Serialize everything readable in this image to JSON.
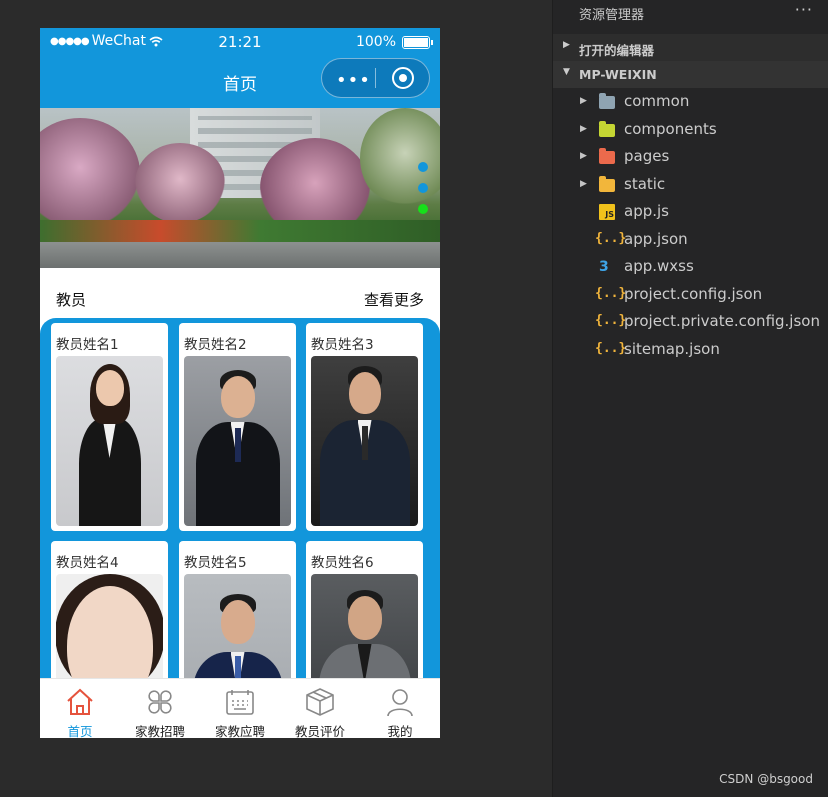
{
  "phone": {
    "status_bar": {
      "signal": "●●●●●",
      "carrier": "WeChat",
      "wifi_icon": "wifi-icon",
      "time": "21:21",
      "battery": "100%"
    },
    "nav": {
      "title": "首页",
      "more_icon": "•••",
      "target_icon": "record-icon"
    },
    "banner": {
      "dots": 3,
      "active_dot": 3,
      "colors": {
        "dot": "#1296db",
        "dot_active": "#16e01a"
      }
    },
    "section": {
      "title": "教员",
      "more": "查看更多"
    },
    "teachers": [
      {
        "name": "教员姓名1"
      },
      {
        "name": "教员姓名2"
      },
      {
        "name": "教员姓名3"
      },
      {
        "name": "教员姓名4"
      },
      {
        "name": "教员姓名5"
      },
      {
        "name": "教员姓名6"
      }
    ],
    "tabs": [
      {
        "label": "首页",
        "icon": "home-icon",
        "active": true
      },
      {
        "label": "家教招聘",
        "icon": "clover-icon",
        "active": false
      },
      {
        "label": "家教应聘",
        "icon": "keyboard-icon",
        "active": false
      },
      {
        "label": "教员评价",
        "icon": "cube-icon",
        "active": false
      },
      {
        "label": "我的",
        "icon": "user-icon",
        "active": false
      }
    ],
    "colors": {
      "primary": "#1296db",
      "tab_active": "#1296db"
    }
  },
  "explorer": {
    "title": "资源管理器",
    "more": "···",
    "open_editors": "打开的编辑器",
    "root": "MP-WEIXIN",
    "folders": [
      {
        "name": "common",
        "color": "#8fa4b2"
      },
      {
        "name": "components",
        "color": "#c5d633"
      },
      {
        "name": "pages",
        "color": "#ec6a4c"
      },
      {
        "name": "static",
        "color": "#f2b63b"
      }
    ],
    "files": [
      {
        "name": "app.js",
        "icon": "js-file-icon",
        "badge": "JS"
      },
      {
        "name": "app.json",
        "icon": "json-file-icon",
        "badge": "{..}"
      },
      {
        "name": "app.wxss",
        "icon": "css-file-icon",
        "badge": "3"
      },
      {
        "name": "project.config.json",
        "icon": "json-file-icon",
        "badge": "{..}"
      },
      {
        "name": "project.private.config.json",
        "icon": "json-file-icon",
        "badge": "{..}"
      },
      {
        "name": "sitemap.json",
        "icon": "json-file-icon",
        "badge": "{..}"
      }
    ]
  },
  "watermark": "CSDN @bsgood"
}
